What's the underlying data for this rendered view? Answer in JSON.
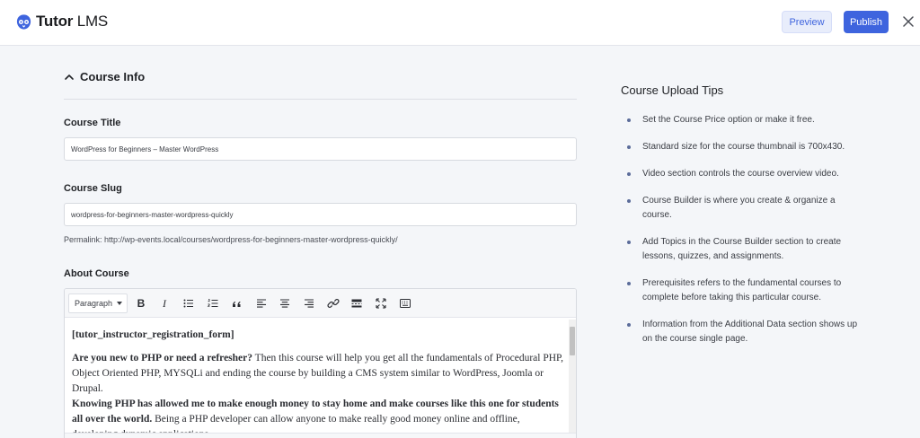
{
  "header": {
    "logo_bold": "Tutor",
    "logo_light": " LMS",
    "preview_label": "Preview",
    "publish_label": "Publish"
  },
  "course_info": {
    "section_title": "Course Info",
    "title_label": "Course Title",
    "title_value": "WordPress for Beginners – Master WordPress",
    "slug_label": "Course Slug",
    "slug_value": "wordpress-for-beginners-master-wordpress-quickly",
    "permalink": "Permalink: http://wp-events.local/courses/wordpress-for-beginners-master-wordpress-quickly/",
    "about_label": "About Course"
  },
  "editor": {
    "format_select": "Paragraph",
    "bold_glyph": "B",
    "italic_glyph": "I",
    "shortcode": "[tutor_instructor_registration_form]",
    "para1_bold": "Are you new to PHP or need a refresher?",
    "para1_rest": " Then this course will help you get all the fundamentals of Procedural PHP, Object Oriented PHP, MYSQLi and ending the course by building a CMS system similar to WordPress, Joomla or Drupal.",
    "para2_bold": "Knowing PHP has allowed me to make enough money to stay home and make courses like this one for students all over the world.",
    "para2_rest": " Being a PHP developer can allow anyone to make really good money online and offline, developing dynamic applications."
  },
  "tips": {
    "title": "Course Upload Tips",
    "items": [
      "Set the Course Price option or make it free.",
      "Standard size for the course thumbnail is 700x430.",
      "Video section controls the course overview video.",
      "Course Builder is where you create & organize a course.",
      "Add Topics in the Course Builder section to create lessons, quizzes, and assignments.",
      "Prerequisites refers to the fundamental courses to complete before taking this particular course.",
      "Information from the Additional Data section shows up on the course single page."
    ]
  },
  "colors": {
    "accent": "#3e64de",
    "preview_bg": "#e8edfb",
    "page_bg": "#f4f6f9"
  }
}
